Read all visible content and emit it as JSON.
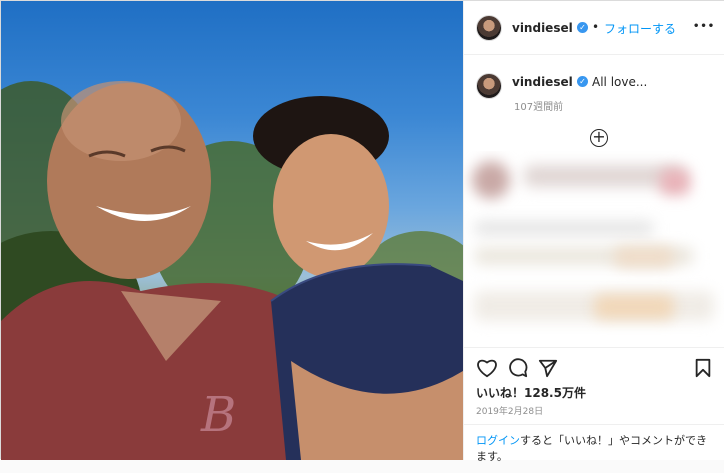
{
  "header": {
    "username": "vindiesel",
    "verified_symbol": "✓",
    "separator": "•",
    "follow_label": "フォローする",
    "more_label": "•••"
  },
  "caption": {
    "username": "vindiesel",
    "text": "All love...",
    "time_ago": "107週間前"
  },
  "load_more_symbol": "+",
  "actions": {
    "likes_label": "いいね！128.5万件",
    "date": "2019年2月28日"
  },
  "login_prompt": {
    "link": "ログイン",
    "text": "すると「いいね！」やコメントができます。"
  },
  "colors": {
    "accent": "#0095f6",
    "verified": "#3897f0",
    "text": "#262626",
    "muted": "#8e8e8e"
  },
  "icons": {
    "like": "heart-icon",
    "comment": "comment-icon",
    "share": "paper-plane-icon",
    "save": "bookmark-icon",
    "load_more": "plus-circle-icon"
  }
}
